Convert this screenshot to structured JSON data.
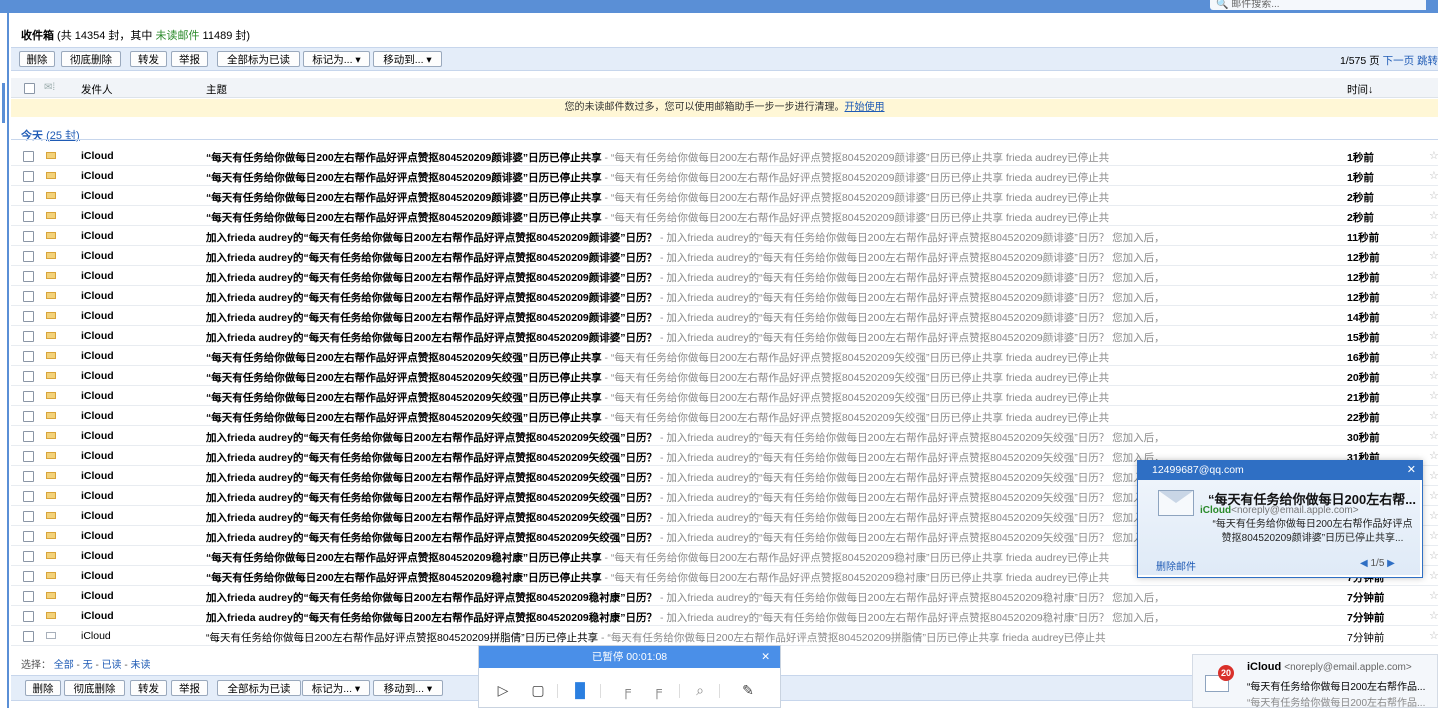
{
  "topbar": {
    "search_placeholder": "🔍 邮件搜索..."
  },
  "header": {
    "title": "收件箱",
    "stats_prefix": " (共 14354 封，其中 ",
    "unread_label": "未读邮件",
    "stats_suffix": " 11489 封)"
  },
  "toolbar": {
    "delete": "删除",
    "delete_forever": "彻底删除",
    "forward": "转发",
    "report": "举报",
    "mark_all_read": "全部标为已读",
    "mark_as": "标记为... ▾",
    "move_to": "移动到... ▾",
    "page_info": "1/575 页",
    "next_page": "下一页",
    "jump": "跳转"
  },
  "columns": {
    "sender": "发件人",
    "subject": "主题",
    "time": "时间↓"
  },
  "notice": {
    "text": "您的未读邮件数过多，您可以使用邮箱助手一步一步进行清理。",
    "link": "开始使用"
  },
  "today": {
    "label": "今天",
    "count": "(25 封)"
  },
  "emails": [
    {
      "from": "iCloud",
      "subject": "“每天有任务给你做每日200左右帮作品好评点赞抠804520209颜诽婆”日历已停止共享",
      "preview": " - “每天有任务给你做每日200左右帮作品好评点赞抠804520209颜诽婆”日历已停止共享 frieda audrey已停止共",
      "time": "1秒前",
      "read": false
    },
    {
      "from": "iCloud",
      "subject": "“每天有任务给你做每日200左右帮作品好评点赞抠804520209颜诽婆”日历已停止共享",
      "preview": " - “每天有任务给你做每日200左右帮作品好评点赞抠804520209颜诽婆”日历已停止共享 frieda audrey已停止共",
      "time": "1秒前",
      "read": false
    },
    {
      "from": "iCloud",
      "subject": "“每天有任务给你做每日200左右帮作品好评点赞抠804520209颜诽婆”日历已停止共享",
      "preview": " - “每天有任务给你做每日200左右帮作品好评点赞抠804520209颜诽婆”日历已停止共享 frieda audrey已停止共",
      "time": "2秒前",
      "read": false
    },
    {
      "from": "iCloud",
      "subject": "“每天有任务给你做每日200左右帮作品好评点赞抠804520209颜诽婆”日历已停止共享",
      "preview": " - “每天有任务给你做每日200左右帮作品好评点赞抠804520209颜诽婆”日历已停止共享 frieda audrey已停止共",
      "time": "2秒前",
      "read": false
    },
    {
      "from": "iCloud",
      "subject": "加入frieda audrey的“每天有任务给你做每日200左右帮作品好评点赞抠804520209颜诽婆”日历？",
      "preview": " - 加入frieda audrey的“每天有任务给你做每日200左右帮作品好评点赞抠804520209颜诽婆”日历？ 您加入后，",
      "time": "11秒前",
      "read": false
    },
    {
      "from": "iCloud",
      "subject": "加入frieda audrey的“每天有任务给你做每日200左右帮作品好评点赞抠804520209颜诽婆”日历？",
      "preview": " - 加入frieda audrey的“每天有任务给你做每日200左右帮作品好评点赞抠804520209颜诽婆”日历？ 您加入后，",
      "time": "12秒前",
      "read": false
    },
    {
      "from": "iCloud",
      "subject": "加入frieda audrey的“每天有任务给你做每日200左右帮作品好评点赞抠804520209颜诽婆”日历？",
      "preview": " - 加入frieda audrey的“每天有任务给你做每日200左右帮作品好评点赞抠804520209颜诽婆”日历？ 您加入后，",
      "time": "12秒前",
      "read": false
    },
    {
      "from": "iCloud",
      "subject": "加入frieda audrey的“每天有任务给你做每日200左右帮作品好评点赞抠804520209颜诽婆”日历？",
      "preview": " - 加入frieda audrey的“每天有任务给你做每日200左右帮作品好评点赞抠804520209颜诽婆”日历？ 您加入后，",
      "time": "12秒前",
      "read": false
    },
    {
      "from": "iCloud",
      "subject": "加入frieda audrey的“每天有任务给你做每日200左右帮作品好评点赞抠804520209颜诽婆”日历？",
      "preview": " - 加入frieda audrey的“每天有任务给你做每日200左右帮作品好评点赞抠804520209颜诽婆”日历？ 您加入后，",
      "time": "14秒前",
      "read": false
    },
    {
      "from": "iCloud",
      "subject": "加入frieda audrey的“每天有任务给你做每日200左右帮作品好评点赞抠804520209颜诽婆”日历？",
      "preview": " - 加入frieda audrey的“每天有任务给你做每日200左右帮作品好评点赞抠804520209颜诽婆”日历？ 您加入后，",
      "time": "15秒前",
      "read": false
    },
    {
      "from": "iCloud",
      "subject": "“每天有任务给你做每日200左右帮作品好评点赞抠804520209矢绞强”日历已停止共享",
      "preview": " - “每天有任务给你做每日200左右帮作品好评点赞抠804520209矢绞强”日历已停止共享 frieda audrey已停止共",
      "time": "16秒前",
      "read": false
    },
    {
      "from": "iCloud",
      "subject": "“每天有任务给你做每日200左右帮作品好评点赞抠804520209矢绞强”日历已停止共享",
      "preview": " - “每天有任务给你做每日200左右帮作品好评点赞抠804520209矢绞强”日历已停止共享 frieda audrey已停止共",
      "time": "20秒前",
      "read": false
    },
    {
      "from": "iCloud",
      "subject": "“每天有任务给你做每日200左右帮作品好评点赞抠804520209矢绞强”日历已停止共享",
      "preview": " - “每天有任务给你做每日200左右帮作品好评点赞抠804520209矢绞强”日历已停止共享 frieda audrey已停止共",
      "time": "21秒前",
      "read": false
    },
    {
      "from": "iCloud",
      "subject": "“每天有任务给你做每日200左右帮作品好评点赞抠804520209矢绞强”日历已停止共享",
      "preview": " - “每天有任务给你做每日200左右帮作品好评点赞抠804520209矢绞强”日历已停止共享 frieda audrey已停止共",
      "time": "22秒前",
      "read": false
    },
    {
      "from": "iCloud",
      "subject": "加入frieda audrey的“每天有任务给你做每日200左右帮作品好评点赞抠804520209矢绞强”日历？",
      "preview": " - 加入frieda audrey的“每天有任务给你做每日200左右帮作品好评点赞抠804520209矢绞强”日历？ 您加入后，",
      "time": "30秒前",
      "read": false
    },
    {
      "from": "iCloud",
      "subject": "加入frieda audrey的“每天有任务给你做每日200左右帮作品好评点赞抠804520209矢绞强”日历？",
      "preview": " - 加入frieda audrey的“每天有任务给你做每日200左右帮作品好评点赞抠804520209矢绞强”日历？ 您加入后，",
      "time": "31秒前",
      "read": false
    },
    {
      "from": "iCloud",
      "subject": "加入frieda audrey的“每天有任务给你做每日200左右帮作品好评点赞抠804520209矢绞强”日历？",
      "preview": " - 加入frieda audrey的“每天有任务给你做每日200左右帮作品好评点赞抠804520209矢绞强”日历？ 您加入后，",
      "time": "",
      "read": false
    },
    {
      "from": "iCloud",
      "subject": "加入frieda audrey的“每天有任务给你做每日200左右帮作品好评点赞抠804520209矢绞强”日历？",
      "preview": " - 加入frieda audrey的“每天有任务给你做每日200左右帮作品好评点赞抠804520209矢绞强”日历？ 您加入后，",
      "time": "",
      "read": false
    },
    {
      "from": "iCloud",
      "subject": "加入frieda audrey的“每天有任务给你做每日200左右帮作品好评点赞抠804520209矢绞强”日历？",
      "preview": " - 加入frieda audrey的“每天有任务给你做每日200左右帮作品好评点赞抠804520209矢绞强”日历？ 您加入后，",
      "time": "",
      "read": false
    },
    {
      "from": "iCloud",
      "subject": "加入frieda audrey的“每天有任务给你做每日200左右帮作品好评点赞抠804520209矢绞强”日历？",
      "preview": " - 加入frieda audrey的“每天有任务给你做每日200左右帮作品好评点赞抠804520209矢绞强”日历？ 您加入后，",
      "time": "",
      "read": false
    },
    {
      "from": "iCloud",
      "subject": "“每天有任务给你做每日200左右帮作品好评点赞抠804520209稳衬康”日历已停止共享",
      "preview": " - “每天有任务给你做每日200左右帮作品好评点赞抠804520209稳衬康”日历已停止共享 frieda audrey已停止共",
      "time": "",
      "read": false
    },
    {
      "from": "iCloud",
      "subject": "“每天有任务给你做每日200左右帮作品好评点赞抠804520209稳衬康”日历已停止共享",
      "preview": " - “每天有任务给你做每日200左右帮作品好评点赞抠804520209稳衬康”日历已停止共享 frieda audrey已停止共",
      "time": "7分钟前",
      "read": false
    },
    {
      "from": "iCloud",
      "subject": "加入frieda audrey的“每天有任务给你做每日200左右帮作品好评点赞抠804520209稳衬康”日历？",
      "preview": " - 加入frieda audrey的“每天有任务给你做每日200左右帮作品好评点赞抠804520209稳衬康”日历？ 您加入后，",
      "time": "7分钟前",
      "read": false
    },
    {
      "from": "iCloud",
      "subject": "加入frieda audrey的“每天有任务给你做每日200左右帮作品好评点赞抠804520209稳衬康”日历？",
      "preview": " - 加入frieda audrey的“每天有任务给你做每日200左右帮作品好评点赞抠804520209稳衬康”日历？ 您加入后，",
      "time": "7分钟前",
      "read": false
    },
    {
      "from": "iCloud",
      "subject": "“每天有任务给你做每日200左右帮作品好评点赞抠804520209拼脂倩”日历已停止共享",
      "preview": " - “每天有任务给你做每日200左右帮作品好评点赞抠804520209拼脂倩”日历已停止共享 frieda audrey已停止共",
      "time": "7分钟前",
      "read": true
    }
  ],
  "select_bar": {
    "prefix": "选择：",
    "all": "全部",
    "none": "无",
    "read": "已读",
    "unread": "未读",
    "sep": " - "
  },
  "popup": {
    "account": "12499687@qq.com",
    "title": "“每天有任务给你做每日200左右帮...",
    "sender_name": "iCloud",
    "sender_email": "<noreply@email.apple.com>",
    "body": "“每天有任务给你做每日200左右帮作品好评点赞抠804520209颜诽婆”日历已停止共享...",
    "delete": "删除邮件",
    "nav": "1/5"
  },
  "recorder": {
    "status": "已暂停 00:01:08"
  },
  "notification": {
    "badge": "20",
    "sender": "iCloud",
    "sender_email": "<noreply@email.apple.com>",
    "line1": "“每天有任务给你做每日200左右帮作品...",
    "line2": "“每天有任务给你做每日200左右帮作品..."
  },
  "colors": {
    "accent": "#5a8fd6",
    "unread_green": "#2a8a2a",
    "link": "#1f5bb5",
    "recorder": "#4a8fe8",
    "badge": "#d9302a"
  }
}
